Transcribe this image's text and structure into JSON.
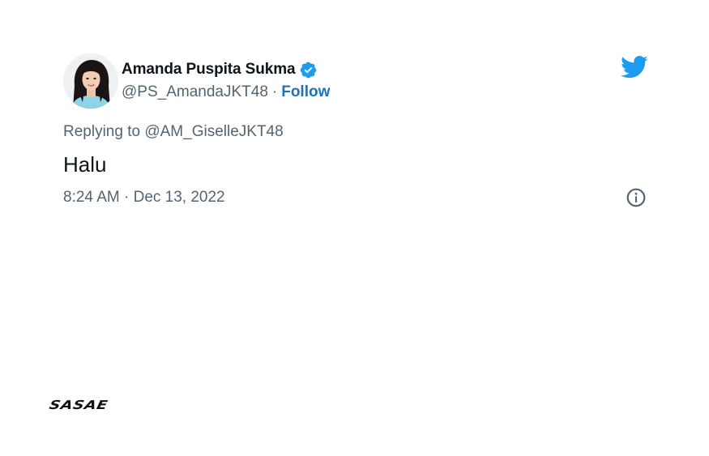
{
  "tweet": {
    "author_name": "Amanda Puspita Sukma",
    "handle": "@PS_AmandaJKT48",
    "separator": "·",
    "follow_label": "Follow",
    "replying_to": "Replying to @AM_GiselleJKT48",
    "text": "Halu",
    "timestamp": "8:24 AM · Dec 13, 2022"
  },
  "icons": {
    "verified": "verified-badge-icon",
    "platform": "twitter-bird-icon",
    "info": "info-icon"
  },
  "brand": {
    "logo_text": "SASAE"
  },
  "colors": {
    "link_blue": "#1d72b8",
    "twitter_blue": "#1d9bf0",
    "secondary_text": "#536471",
    "primary_text": "#0f1419"
  }
}
